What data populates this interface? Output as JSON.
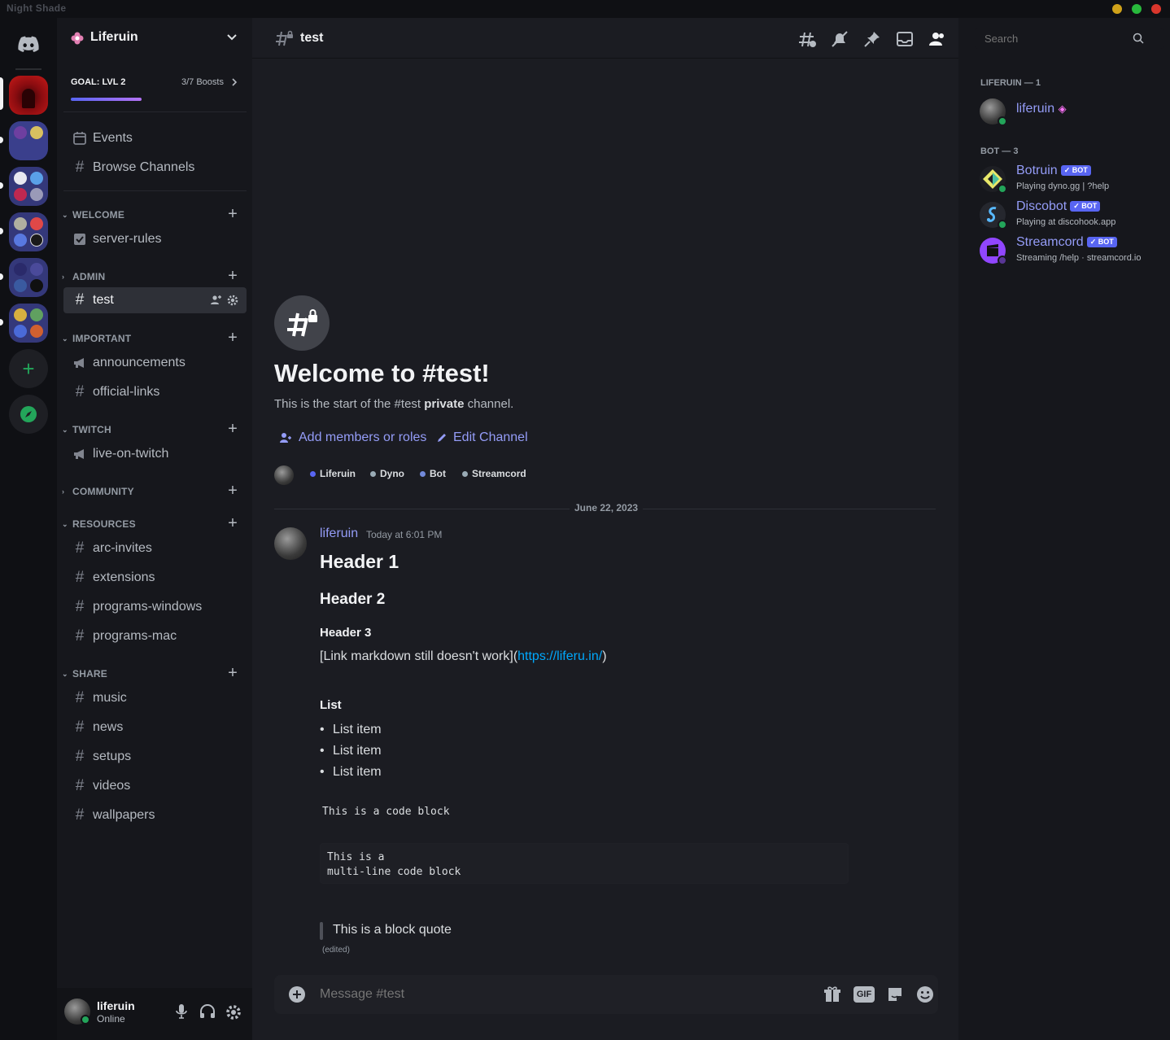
{
  "window": {
    "title": "Night Shade"
  },
  "colors": {
    "accent": "#5865f2",
    "link": "#00a8fc",
    "online": "#23a55a",
    "bg_main": "#1b1c22",
    "bg_sidebar": "#16171c"
  },
  "server": {
    "name": "Liferuin",
    "goal_label": "GOAL: LVL 2",
    "boosts": "3/7 Boosts",
    "goal_progress": 0.57
  },
  "sidebar": {
    "events": "Events",
    "browse": "Browse Channels",
    "categories": [
      {
        "name": "WELCOME",
        "channels": [
          {
            "name": "server-rules",
            "icon": "rules-icon"
          }
        ]
      },
      {
        "name": "ADMIN",
        "channels": [
          {
            "name": "test",
            "icon": "locked-hash-icon",
            "active": true
          }
        ]
      },
      {
        "name": "IMPORTANT",
        "channels": [
          {
            "name": "announcements",
            "icon": "megaphone-icon"
          },
          {
            "name": "official-links",
            "icon": "hash-icon"
          }
        ]
      },
      {
        "name": "TWITCH",
        "channels": [
          {
            "name": "live-on-twitch",
            "icon": "megaphone-icon"
          }
        ]
      },
      {
        "name": "COMMUNITY",
        "channels": []
      },
      {
        "name": "RESOURCES",
        "channels": [
          {
            "name": "arc-invites"
          },
          {
            "name": "extensions"
          },
          {
            "name": "programs-windows"
          },
          {
            "name": "programs-mac"
          }
        ]
      },
      {
        "name": "SHARE",
        "channels": [
          {
            "name": "music"
          },
          {
            "name": "news"
          },
          {
            "name": "setups"
          },
          {
            "name": "videos"
          },
          {
            "name": "wallpapers"
          }
        ]
      }
    ]
  },
  "user": {
    "name": "liferuin",
    "status": "Online"
  },
  "header": {
    "channel": "test",
    "search_placeholder": "Search"
  },
  "welcome": {
    "title": "Welcome to #test!",
    "desc_prefix": "This is the start of the #test ",
    "desc_bold": "private",
    "desc_suffix": " channel.",
    "add_members": "Add members or roles",
    "edit_channel": "Edit Channel",
    "roles": [
      {
        "name": "Liferuin",
        "color": "#5865f2"
      },
      {
        "name": "Dyno",
        "color": "#99aab5"
      },
      {
        "name": "Bot",
        "color": "#7289da"
      },
      {
        "name": "Streamcord",
        "color": "#99aab5"
      }
    ]
  },
  "divider_date": "June 22, 2023",
  "message": {
    "author": "liferuin",
    "timestamp": "Today at 6:01 PM",
    "h1": "Header 1",
    "h2": "Header 2",
    "h3": "Header 3",
    "link_prefix": "[Link markdown still doesn't work](",
    "link_url": "https://liferu.in/",
    "link_suffix": ")",
    "list_title": "List",
    "list_items": [
      "List item",
      "List item",
      "List item"
    ],
    "inline_code": "This is a code block",
    "code_line1": "This is a",
    "code_line2": "multi-line code block",
    "quote": "This is a block quote",
    "edited": "(edited)"
  },
  "composer": {
    "placeholder": "Message #test",
    "gif": "GIF"
  },
  "members": {
    "groups": [
      {
        "title": "LIFERUIN — 1",
        "members": [
          {
            "name": "liferuin",
            "activity": ""
          }
        ]
      },
      {
        "title": "BOT — 3",
        "members": [
          {
            "name": "Botruin",
            "badge": "BOT",
            "activity": "Playing dyno.gg | ?help"
          },
          {
            "name": "Discobot",
            "badge": "BOT",
            "activity": "Playing at discohook.app"
          },
          {
            "name": "Streamcord",
            "badge": "BOT",
            "activity": "Streaming /help · streamcord.io"
          }
        ]
      }
    ]
  }
}
